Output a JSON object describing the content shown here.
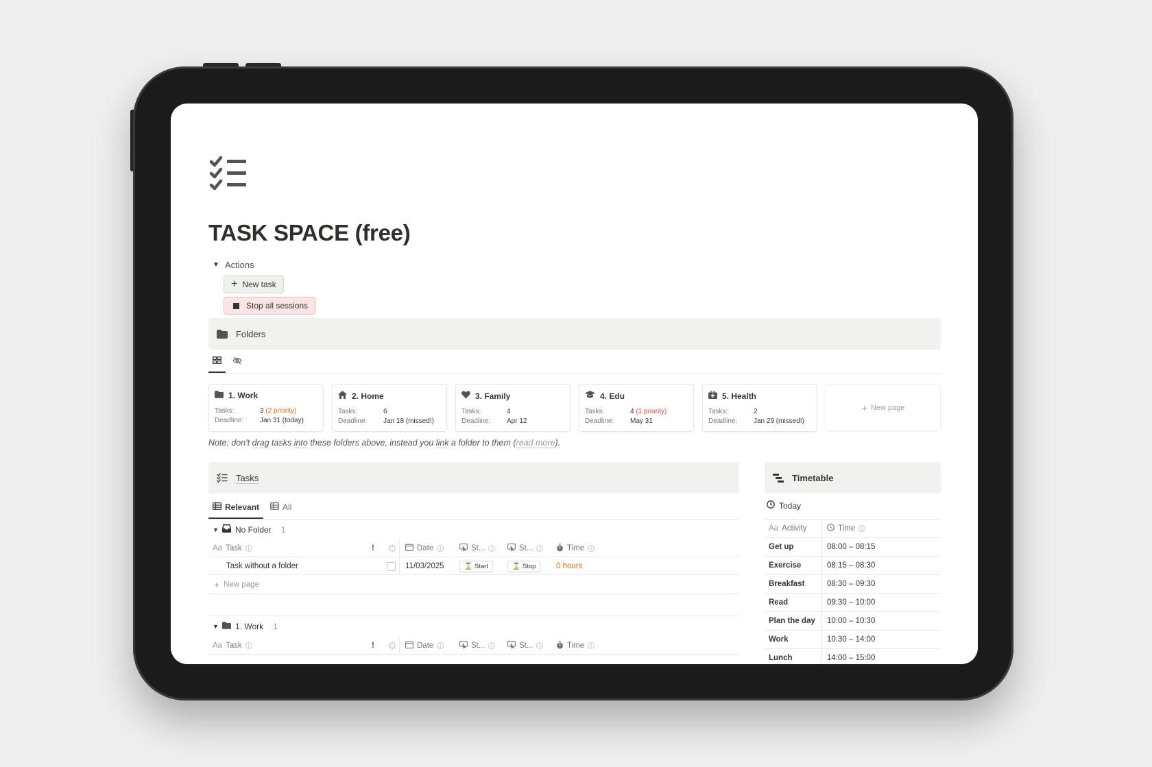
{
  "page": {
    "title": "TASK SPACE (free)",
    "icon": "checklist-icon"
  },
  "actions": {
    "toggle_label": "Actions",
    "new_task_label": "New task",
    "stop_sessions_label": "Stop all sessions"
  },
  "folders": {
    "callout_label": "Folders",
    "cards": [
      {
        "title": "1. Work",
        "icon": "folder-icon",
        "tasks_key": "Tasks:",
        "tasks": "3",
        "tasks_extra": "(2 priority)",
        "deadline_key": "Deadline:",
        "deadline": "Jan 31 (today)",
        "deadline_color": "#d9730d"
      },
      {
        "title": "2. Home",
        "icon": "home-icon",
        "tasks_key": "Tasks:",
        "tasks": "6",
        "tasks_extra": "",
        "deadline_key": "Deadline:",
        "deadline": "Jan 18 (missed!)",
        "deadline_color": "#d44c47"
      },
      {
        "title": "3. Family",
        "icon": "heart-icon",
        "tasks_key": "Tasks:",
        "tasks": "4",
        "tasks_extra": "",
        "deadline_key": "Deadline:",
        "deadline": "Apr 12",
        "deadline_color": "#37352f"
      },
      {
        "title": "4. Edu",
        "icon": "graduation-cap-icon",
        "tasks_key": "Tasks:",
        "tasks": "4",
        "tasks_extra": "(1 priority)",
        "deadline_key": "Deadline:",
        "deadline": "May 31",
        "deadline_color": "#37352f"
      },
      {
        "title": "5. Health",
        "icon": "medical-kit-icon",
        "tasks_key": "Tasks:",
        "tasks": "2",
        "tasks_extra": "",
        "deadline_key": "Deadline:",
        "deadline": "Jan 29 (missed!)",
        "deadline_color": "#d44c47"
      }
    ],
    "new_page_label": "New page"
  },
  "note": {
    "p1": "Note: don't ",
    "drag": "drag",
    "p2": " tasks ",
    "into": "into",
    "p3": " these folders above, instead you ",
    "link": "link",
    "p4": " a folder to them (",
    "read_more": "read more",
    "p5": ")."
  },
  "tasks": {
    "callout_label": "Tasks",
    "tabs": [
      {
        "label": "Relevant",
        "active": true
      },
      {
        "label": "All",
        "active": false
      }
    ],
    "columns": {
      "task": "Task",
      "task_prefix": "Aa",
      "priority": "!",
      "date": "Date",
      "start": "St...",
      "stop": "St...",
      "time": "Time"
    },
    "groups": [
      {
        "name": "No Folder",
        "count": "1",
        "rows": [
          {
            "task": "Task without a folder",
            "date": "11/03/2025",
            "start_btn": "Start",
            "stop_btn": "Stop",
            "time": "0 hours"
          }
        ],
        "new_page_label": "New page"
      },
      {
        "name": "1. Work",
        "count": "1"
      }
    ]
  },
  "timetable": {
    "callout_label": "Timetable",
    "view_label": "Today",
    "col_activity": "Activity",
    "col_activity_prefix": "Aa",
    "col_time": "Time",
    "rows": [
      {
        "activity": "Get up",
        "time": "08:00 – 08:15"
      },
      {
        "activity": "Exercise",
        "time": "08:15 – 08:30"
      },
      {
        "activity": "Breakfast",
        "time": "08:30 – 09:30"
      },
      {
        "activity": "Read",
        "time": "09:30 – 10:00"
      },
      {
        "activity": "Plan the day",
        "time": "10:00 – 10:30"
      },
      {
        "activity": "Work",
        "time": "10:30 – 14:00"
      },
      {
        "activity": "Lunch",
        "time": "14:00 – 15:00"
      }
    ]
  },
  "colors": {
    "red": "#d44c47",
    "orange": "#d9730d",
    "callout_bg": "#f1f1ef",
    "new_task_bg": "#edf3ec",
    "stop_bg": "#fbe4e4"
  }
}
